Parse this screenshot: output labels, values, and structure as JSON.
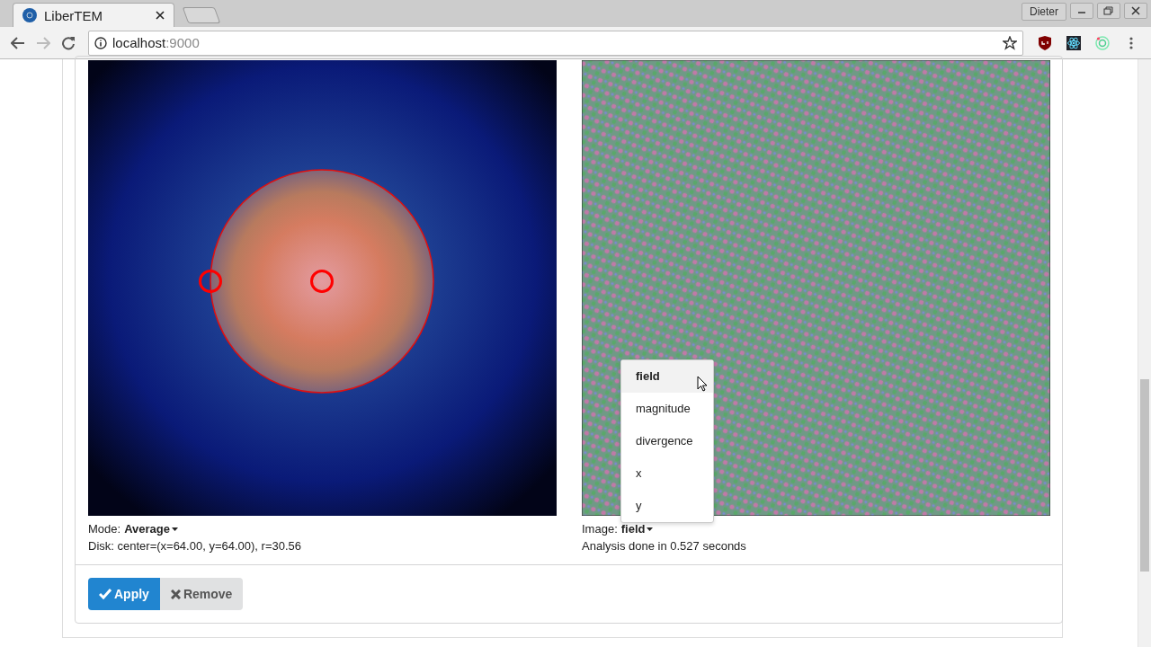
{
  "browser": {
    "tab_title": "LiberTEM",
    "url_host": "localhost",
    "url_port": ":9000",
    "profile": "Dieter"
  },
  "panels": [
    {
      "kind": "diffraction",
      "selector_label": "Mode:",
      "selector_value": "Average",
      "info": "Disk: center=(x=64.00, y=64.00), r=30.56"
    },
    {
      "kind": "result",
      "selector_label": "Image:",
      "selector_value": "field",
      "info": "Analysis done in 0.527 seconds",
      "menu": [
        {
          "label": "field",
          "selected": true
        },
        {
          "label": "magnitude",
          "selected": false
        },
        {
          "label": "divergence",
          "selected": false
        },
        {
          "label": "x",
          "selected": false
        },
        {
          "label": "y",
          "selected": false
        }
      ]
    }
  ],
  "buttons": [
    {
      "label": "Apply",
      "kind": "primary"
    },
    {
      "label": "Remove",
      "kind": "secondary"
    }
  ]
}
